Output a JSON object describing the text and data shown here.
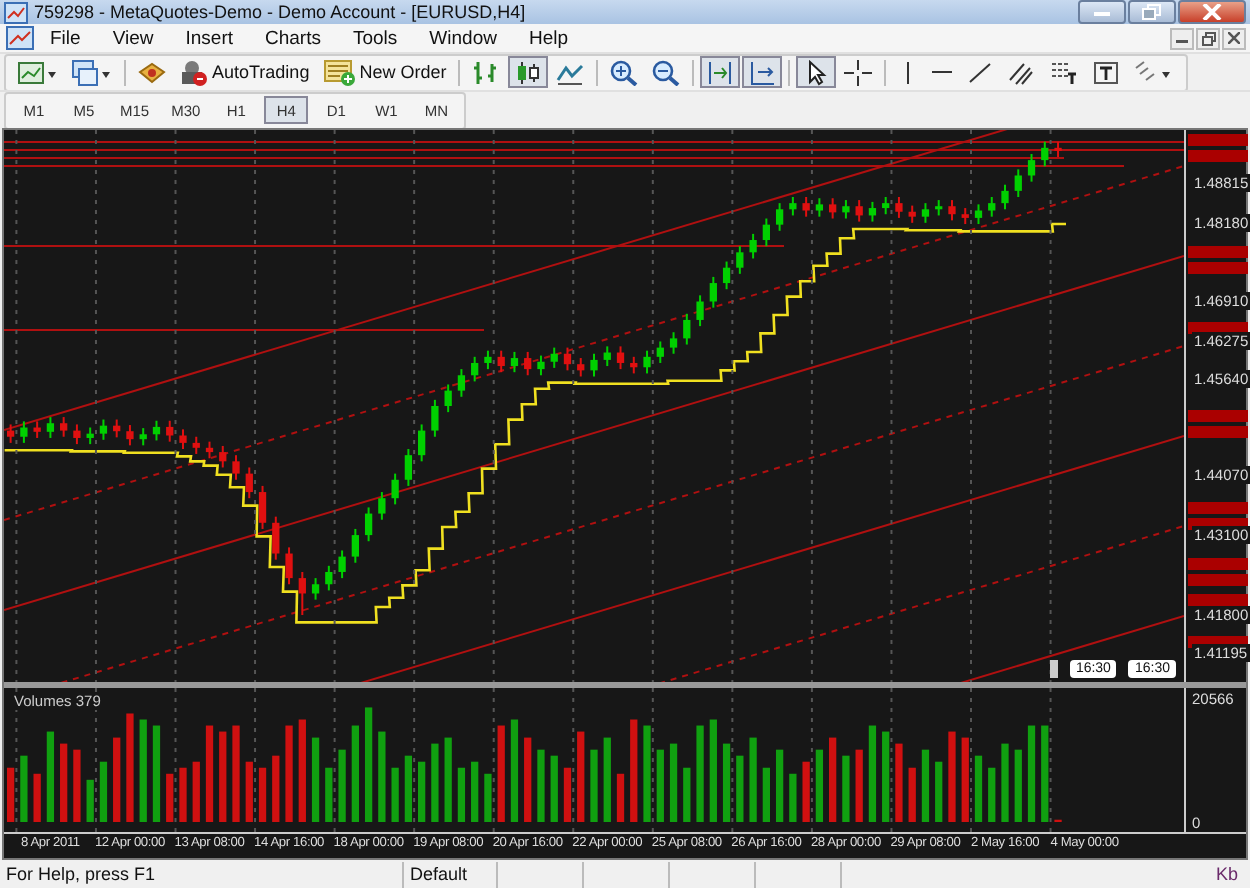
{
  "window": {
    "title": "759298 - MetaQuotes-Demo - Demo Account - [EURUSD,H4]"
  },
  "menu": [
    "File",
    "View",
    "Insert",
    "Charts",
    "Tools",
    "Window",
    "Help"
  ],
  "toolbar": {
    "buttons": [
      {
        "label": "AutoTrading"
      },
      {
        "label": "New Order"
      }
    ],
    "chart_types": [
      {
        "selected": false
      },
      {
        "selected": true
      },
      {
        "selected": false
      }
    ]
  },
  "timeframes": [
    {
      "label": "M1",
      "selected": false
    },
    {
      "label": "M5",
      "selected": false
    },
    {
      "label": "M15",
      "selected": false
    },
    {
      "label": "M30",
      "selected": false
    },
    {
      "label": "H1",
      "selected": false
    },
    {
      "label": "H4",
      "selected": true
    },
    {
      "label": "D1",
      "selected": false
    },
    {
      "label": "W1",
      "selected": false
    },
    {
      "label": "MN",
      "selected": false
    }
  ],
  "chart": {
    "chart_data": {
      "type": "candlestick",
      "grid": true,
      "ylim": [
        1.4071,
        1.4969
      ],
      "yticks": [
        {
          "value": 1.48815,
          "label": "1.48815"
        },
        {
          "value": 1.4818,
          "label": "1.48180"
        },
        {
          "value": 1.4691,
          "label": "1.46910"
        },
        {
          "value": 1.46275,
          "label": "1.46275"
        },
        {
          "value": 1.4564,
          "label": "1.45640"
        },
        {
          "value": 1.4407,
          "label": "1.44070"
        },
        {
          "value": 1.431,
          "label": "1.43100"
        },
        {
          "value": 1.418,
          "label": "1.41800"
        },
        {
          "value": 1.41195,
          "label": "1.41195"
        }
      ],
      "categories": [
        null,
        null,
        null,
        null,
        null,
        null,
        null,
        null,
        null,
        null,
        null,
        null,
        null,
        null,
        null,
        null,
        null,
        null,
        null,
        null,
        null,
        null,
        null,
        null,
        null,
        null,
        null,
        null,
        null,
        null,
        null,
        null,
        null,
        null,
        null,
        null,
        null,
        null,
        null,
        null,
        null,
        null,
        null,
        null,
        null,
        null,
        null,
        null,
        null,
        null,
        null,
        null,
        null,
        null,
        null,
        null,
        null,
        null,
        null,
        null,
        null,
        null,
        null,
        null,
        null,
        null,
        null,
        null,
        null,
        null,
        null,
        null,
        null,
        null,
        null,
        null,
        null,
        null,
        null,
        null,
        null,
        null,
        null,
        null,
        null,
        null,
        null,
        null,
        null
      ],
      "ohlc": [
        [
          1.448,
          1.449,
          1.446,
          1.447
        ],
        [
          1.447,
          1.4495,
          1.446,
          1.4485
        ],
        [
          1.4485,
          1.4495,
          1.4468,
          1.4478
        ],
        [
          1.4478,
          1.4502,
          1.4468,
          1.4492
        ],
        [
          1.4492,
          1.4502,
          1.447,
          1.448
        ],
        [
          1.448,
          1.449,
          1.4458,
          1.4468
        ],
        [
          1.4468,
          1.4485,
          1.4458,
          1.4475
        ],
        [
          1.4475,
          1.4498,
          1.4465,
          1.4488
        ],
        [
          1.4488,
          1.4498,
          1.4469,
          1.4479
        ],
        [
          1.4479,
          1.4489,
          1.4456,
          1.4466
        ],
        [
          1.4466,
          1.4484,
          1.4456,
          1.4474
        ],
        [
          1.4474,
          1.4496,
          1.4464,
          1.4486
        ],
        [
          1.4486,
          1.4496,
          1.4462,
          1.4472
        ],
        [
          1.4472,
          1.4482,
          1.445,
          1.446
        ],
        [
          1.446,
          1.447,
          1.4442,
          1.4452
        ],
        [
          1.4452,
          1.4462,
          1.4435,
          1.4445
        ],
        [
          1.4445,
          1.4455,
          1.442,
          1.443
        ],
        [
          1.443,
          1.444,
          1.44,
          1.441
        ],
        [
          1.441,
          1.442,
          1.437,
          1.438
        ],
        [
          1.438,
          1.439,
          1.432,
          1.433
        ],
        [
          1.433,
          1.434,
          1.427,
          1.428
        ],
        [
          1.428,
          1.429,
          1.423,
          1.424
        ],
        [
          1.424,
          1.425,
          1.418,
          1.4215
        ],
        [
          1.4215,
          1.424,
          1.4205,
          1.423
        ],
        [
          1.423,
          1.426,
          1.422,
          1.425
        ],
        [
          1.425,
          1.4285,
          1.424,
          1.4275
        ],
        [
          1.4275,
          1.432,
          1.4265,
          1.431
        ],
        [
          1.431,
          1.4355,
          1.43,
          1.4345
        ],
        [
          1.4345,
          1.438,
          1.4335,
          1.437
        ],
        [
          1.437,
          1.441,
          1.436,
          1.44
        ],
        [
          1.44,
          1.445,
          1.439,
          1.444
        ],
        [
          1.444,
          1.449,
          1.443,
          1.448
        ],
        [
          1.448,
          1.453,
          1.447,
          1.452
        ],
        [
          1.452,
          1.4555,
          1.451,
          1.4545
        ],
        [
          1.4545,
          1.458,
          1.4535,
          1.457
        ],
        [
          1.457,
          1.46,
          1.456,
          1.459
        ],
        [
          1.459,
          1.461,
          1.458,
          1.46
        ],
        [
          1.46,
          1.461,
          1.4575,
          1.4585
        ],
        [
          1.4585,
          1.4608,
          1.4575,
          1.4598
        ],
        [
          1.4598,
          1.4608,
          1.457,
          1.458
        ],
        [
          1.458,
          1.4602,
          1.457,
          1.4592
        ],
        [
          1.4592,
          1.4615,
          1.4582,
          1.4605
        ],
        [
          1.4605,
          1.4615,
          1.4578,
          1.4588
        ],
        [
          1.4588,
          1.4598,
          1.4568,
          1.4578
        ],
        [
          1.4578,
          1.4605,
          1.4568,
          1.4595
        ],
        [
          1.4595,
          1.4617,
          1.4585,
          1.4607
        ],
        [
          1.4607,
          1.4617,
          1.458,
          1.459
        ],
        [
          1.459,
          1.46,
          1.4573,
          1.4583
        ],
        [
          1.4583,
          1.461,
          1.4573,
          1.46
        ],
        [
          1.46,
          1.4625,
          1.459,
          1.4615
        ],
        [
          1.4615,
          1.464,
          1.4605,
          1.463
        ],
        [
          1.463,
          1.467,
          1.462,
          1.466
        ],
        [
          1.466,
          1.47,
          1.465,
          1.469
        ],
        [
          1.469,
          1.473,
          1.468,
          1.472
        ],
        [
          1.472,
          1.4755,
          1.471,
          1.4745
        ],
        [
          1.4745,
          1.478,
          1.4735,
          1.477
        ],
        [
          1.477,
          1.48,
          1.476,
          1.479
        ],
        [
          1.479,
          1.4825,
          1.478,
          1.4815
        ],
        [
          1.4815,
          1.485,
          1.4805,
          1.484
        ],
        [
          1.484,
          1.486,
          1.483,
          1.485
        ],
        [
          1.485,
          1.486,
          1.4828,
          1.4838
        ],
        [
          1.4838,
          1.4858,
          1.4828,
          1.4848
        ],
        [
          1.4848,
          1.4858,
          1.4825,
          1.4835
        ],
        [
          1.4835,
          1.4855,
          1.4825,
          1.4845
        ],
        [
          1.4845,
          1.4855,
          1.482,
          1.483
        ],
        [
          1.483,
          1.4852,
          1.482,
          1.4842
        ],
        [
          1.4842,
          1.486,
          1.4832,
          1.485
        ],
        [
          1.485,
          1.486,
          1.4826,
          1.4836
        ],
        [
          1.4836,
          1.4846,
          1.4818,
          1.4828
        ],
        [
          1.4828,
          1.485,
          1.4818,
          1.484
        ],
        [
          1.484,
          1.4855,
          1.483,
          1.4845
        ],
        [
          1.4845,
          1.4855,
          1.4822,
          1.4832
        ],
        [
          1.4832,
          1.4842,
          1.4816,
          1.4826
        ],
        [
          1.4826,
          1.4848,
          1.4816,
          1.4838
        ],
        [
          1.4838,
          1.486,
          1.4828,
          1.485
        ],
        [
          1.485,
          1.488,
          1.484,
          1.487
        ],
        [
          1.487,
          1.4905,
          1.486,
          1.4895
        ],
        [
          1.4895,
          1.493,
          1.4885,
          1.492
        ],
        [
          1.492,
          1.495,
          1.491,
          1.494
        ],
        [
          1.494,
          1.495,
          1.4925,
          1.4935
        ],
        null,
        null,
        null,
        null,
        null,
        null,
        null,
        null,
        null
      ]
    },
    "time_marks": [
      "16:30",
      "16:30"
    ],
    "volume": {
      "label": "Volumes 379",
      "chart_data": {
        "type": "bar",
        "grid": true,
        "ylim": [
          0,
          20566
        ],
        "categories": [
          null,
          null,
          null,
          "8 Apr 2011",
          null,
          null,
          null,
          null,
          null,
          "12 Apr 00:00",
          null,
          null,
          null,
          null,
          null,
          "13 Apr 08:00",
          null,
          null,
          null,
          null,
          null,
          "14 Apr 16:00",
          null,
          null,
          null,
          null,
          null,
          "18 Apr 00:00",
          null,
          null,
          null,
          null,
          null,
          "19 Apr 08:00",
          null,
          null,
          null,
          null,
          null,
          "20 Apr 16:00",
          null,
          null,
          null,
          null,
          null,
          "22 Apr 00:00",
          null,
          null,
          null,
          null,
          null,
          "25 Apr 08:00",
          null,
          null,
          null,
          null,
          null,
          "26 Apr 16:00",
          null,
          null,
          null,
          null,
          null,
          "28 Apr 00:00",
          null,
          null,
          null,
          null,
          null,
          "29 Apr 08:00",
          null,
          null,
          null,
          null,
          null,
          "2 May 16:00",
          null,
          null,
          null,
          null,
          null,
          "4 May 00:00",
          null,
          null,
          null,
          null,
          null,
          null,
          null
        ],
        "yticks": [
          {
            "value": 20566,
            "label": "20566"
          },
          {
            "value": 0,
            "label": "0"
          }
        ],
        "values": [
          9000,
          11000,
          8000,
          15000,
          13000,
          12000,
          7000,
          10000,
          14000,
          18000,
          17000,
          16000,
          8000,
          9000,
          10000,
          16000,
          15000,
          16000,
          10000,
          9000,
          11000,
          16000,
          17000,
          14000,
          9000,
          12000,
          16000,
          19000,
          15000,
          9000,
          11000,
          10000,
          13000,
          14000,
          9000,
          10000,
          8000,
          16000,
          17000,
          14000,
          12000,
          11000,
          9000,
          15000,
          12000,
          14000,
          8000,
          17000,
          16000,
          12000,
          13000,
          9000,
          16000,
          17000,
          13000,
          11000,
          14000,
          9000,
          12000,
          8000,
          10000,
          12000,
          14000,
          11000,
          12000,
          16000,
          15000,
          13000,
          9000,
          12000,
          10000,
          15000,
          14000,
          11000,
          9000,
          13000,
          12000,
          16000,
          16000,
          379,
          null,
          null,
          null,
          null,
          null,
          null,
          null,
          null,
          null
        ]
      }
    }
  },
  "status_bar": {
    "cells": [
      "For Help, press F1",
      "Default"
    ],
    "traffic": "Kb"
  }
}
